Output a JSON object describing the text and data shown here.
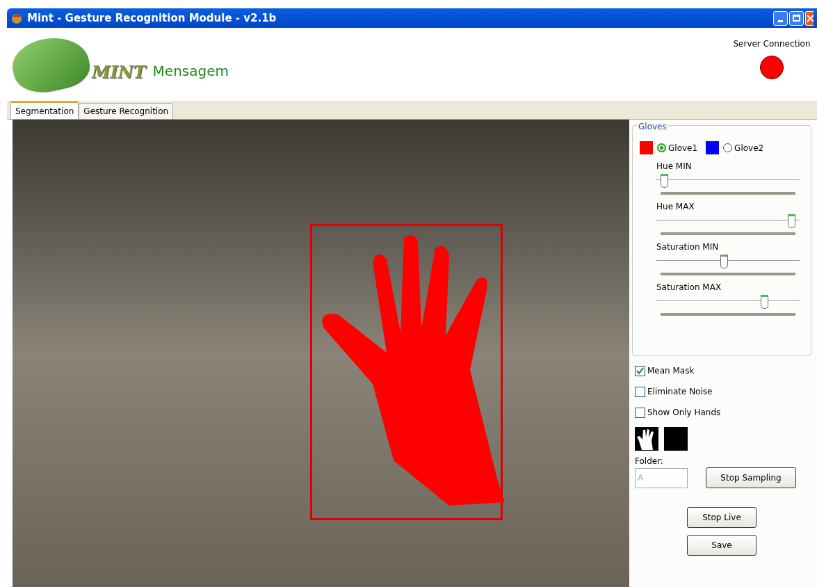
{
  "window": {
    "title": "Mint - Gesture Recognition Module - v2.1b"
  },
  "header": {
    "logo_text": "MINT",
    "message": "Mensagem",
    "server_label": "Server Connection",
    "server_connected": false
  },
  "tabs": [
    {
      "label": "Segmentation",
      "selected": true
    },
    {
      "label": "Gesture Recognition",
      "selected": false
    }
  ],
  "gloves": {
    "title": "Gloves",
    "options": [
      {
        "label": "Glove1",
        "color": "#ff0000",
        "selected": true
      },
      {
        "label": "Glove2",
        "color": "#0000ff",
        "selected": false
      }
    ],
    "sliders": [
      {
        "label": "Hue MIN",
        "level": 0.03
      },
      {
        "label": "Hue MAX",
        "level": 0.97
      },
      {
        "label": "Saturation MIN",
        "level": 0.47
      },
      {
        "label": "Saturation MAX",
        "level": 0.77
      }
    ]
  },
  "checkboxes": [
    {
      "label": "Mean Mask",
      "checked": true
    },
    {
      "label": "Eliminate Noise",
      "checked": false
    },
    {
      "label": "Show Only Hands",
      "checked": false
    }
  ],
  "folder": {
    "label": "Folder:",
    "value": "A",
    "disabled": true
  },
  "buttons": {
    "sampling": "Stop Sampling",
    "live": "Stop Live",
    "save": "Save"
  }
}
